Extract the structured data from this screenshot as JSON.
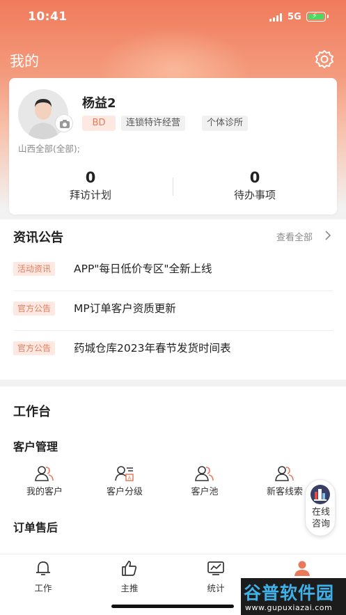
{
  "status_bar": {
    "time": "10:41",
    "network": "5G"
  },
  "page": {
    "title": "我的"
  },
  "profile": {
    "name": "杨益2",
    "tags": [
      "BD",
      "连锁特许经营",
      "个体诊所"
    ],
    "region": "山西全部(全部);",
    "stats": [
      {
        "value": "0",
        "label": "拜访计划"
      },
      {
        "value": "0",
        "label": "待办事项"
      }
    ]
  },
  "news": {
    "title": "资讯公告",
    "view_all": "查看全部",
    "items": [
      {
        "badge": "活动资讯",
        "text": "APP\"每日低价专区\"全新上线"
      },
      {
        "badge": "官方公告",
        "text": "MP订单客户资质更新"
      },
      {
        "badge": "官方公告",
        "text": "药城仓库2023年春节发货时间表"
      }
    ]
  },
  "workbench": {
    "title": "工作台",
    "customer_section": {
      "title": "客户管理",
      "items": [
        {
          "label": "我的客户",
          "icon": "users-icon"
        },
        {
          "label": "客户分级",
          "icon": "user-rank-icon"
        },
        {
          "label": "客户池",
          "icon": "users-pool-icon"
        },
        {
          "label": "新客线索",
          "icon": "users-lead-icon"
        }
      ]
    },
    "order_section": {
      "title": "订单售后"
    }
  },
  "float_chat": {
    "label_line1": "在线",
    "label_line2": "咨询"
  },
  "tabs": [
    {
      "label": "工作",
      "icon": "bell-icon"
    },
    {
      "label": "主推",
      "icon": "thumbs-up-icon"
    },
    {
      "label": "统计",
      "icon": "chart-icon"
    },
    {
      "label": "我的",
      "icon": "person-icon",
      "active": true
    }
  ],
  "watermark": {
    "main": "谷普软件园",
    "sub": "www.gupuxiazai.com"
  },
  "colors": {
    "accent": "#e8795b",
    "header_gradient_top": "#f07b5c",
    "tag_bg": "#fde9e1"
  }
}
